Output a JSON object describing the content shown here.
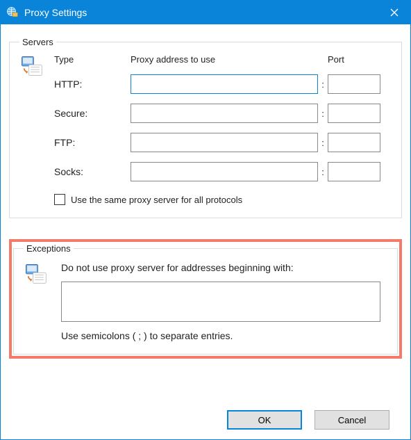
{
  "window": {
    "title": "Proxy Settings"
  },
  "servers": {
    "legend": "Servers",
    "headers": {
      "type": "Type",
      "address": "Proxy address to use",
      "port": "Port"
    },
    "rows": {
      "http": {
        "label": "HTTP:",
        "address": "",
        "port": ""
      },
      "secure": {
        "label": "Secure:",
        "address": "",
        "port": ""
      },
      "ftp": {
        "label": "FTP:",
        "address": "",
        "port": ""
      },
      "socks": {
        "label": "Socks:",
        "address": "",
        "port": ""
      }
    },
    "same_for_all": {
      "checked": false,
      "label": "Use the same proxy server for all protocols"
    }
  },
  "exceptions": {
    "legend": "Exceptions",
    "instruction": "Do not use proxy server for addresses beginning with:",
    "value": "",
    "note": "Use semicolons ( ; ) to separate entries."
  },
  "buttons": {
    "ok": "OK",
    "cancel": "Cancel"
  },
  "colon": ":"
}
